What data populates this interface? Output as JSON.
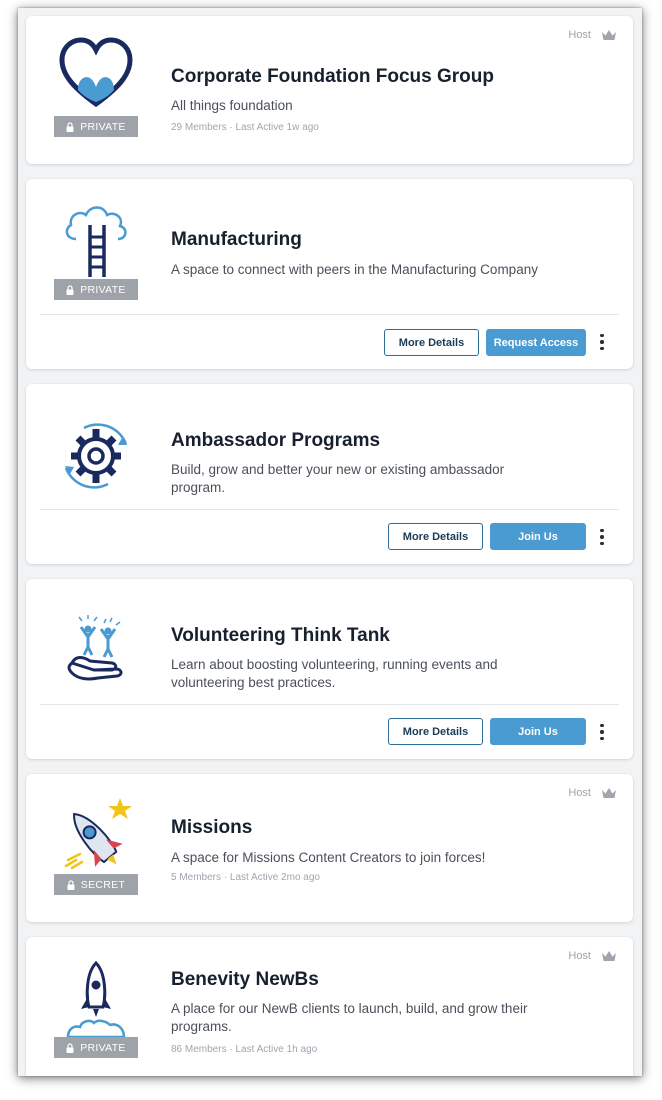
{
  "groups": [
    {
      "title": "Corporate Foundation Focus Group",
      "description": "All things foundation",
      "privacy": "PRIVATE",
      "members": "29 Members",
      "separator": "·",
      "last_active": "Last Active 1w ago",
      "host_label": "Host",
      "logo_icon": "heart-hands-icon"
    },
    {
      "title": "Manufacturing",
      "description": "A space to connect with peers in the Manufacturing Company",
      "privacy": "PRIVATE",
      "more_details": "More Details",
      "action": "Request Access",
      "logo_icon": "cloud-ladder-icon"
    },
    {
      "title": "Ambassador Programs",
      "description": "Build, grow and better your new or existing ambassador program.",
      "more_details": "More Details",
      "action": "Join Us",
      "logo_icon": "gear-cycle-icon"
    },
    {
      "title": "Volunteering Think Tank",
      "description": "Learn about boosting volunteering, running events and volunteering best practices.",
      "more_details": "More Details",
      "action": "Join Us",
      "logo_icon": "hand-people-icon"
    },
    {
      "title": "Missions",
      "description": "A space for Missions Content Creators to join forces!",
      "privacy": "SECRET",
      "members": "5 Members",
      "separator": "·",
      "last_active": "Last Active 2mo ago",
      "host_label": "Host",
      "logo_icon": "rocket-star-icon"
    },
    {
      "title": "Benevity NewBs",
      "description": "A place for our NewB clients to launch, build, and grow their programs.",
      "privacy": "PRIVATE",
      "members": "86 Members",
      "separator": "·",
      "last_active": "Last Active 1h ago",
      "host_label": "Host",
      "logo_icon": "rocket-launch-icon"
    }
  ],
  "colors": {
    "primary": "#4a9bd1",
    "navy": "#1b2a5e",
    "badge": "#9ea3aa"
  }
}
